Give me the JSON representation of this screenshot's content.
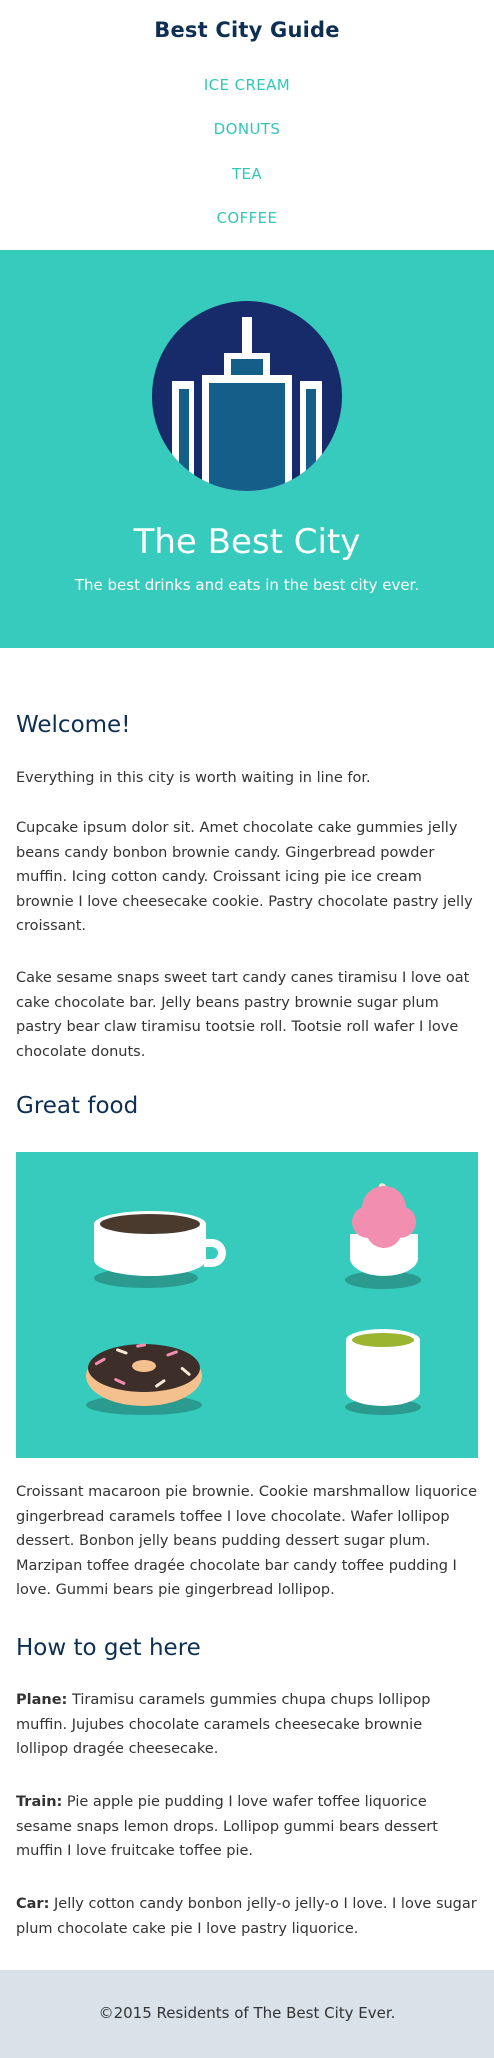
{
  "header": {
    "title": "Best City Guide",
    "nav": [
      "ICE CREAM",
      "DONUTS",
      "TEA",
      "COFFEE"
    ]
  },
  "hero": {
    "title": "The Best City",
    "tagline": "The best drinks and eats in the best city ever."
  },
  "welcome": {
    "heading": "Welcome!",
    "paragraphs": [
      "Everything in this city is worth waiting in line for.",
      "Cupcake ipsum dolor sit. Amet chocolate cake gummies jelly beans candy bonbon brownie candy. Gingerbread powder muffin. Icing cotton candy. Croissant icing pie ice cream brownie I love cheesecake cookie. Pastry chocolate pastry jelly croissant.",
      "Cake sesame snaps sweet tart candy canes tiramisu I love oat cake chocolate bar. Jelly beans pastry brownie sugar plum pastry bear claw tiramisu tootsie roll. Tootsie roll wafer I love chocolate donuts."
    ]
  },
  "food": {
    "heading": "Great food",
    "paragraph": "Croissant macaroon pie brownie. Cookie marshmallow liquorice gingerbread caramels toffee I love chocolate. Wafer lollipop dessert. Bonbon jelly beans pudding dessert sugar plum. Marzipan toffee dragée chocolate bar candy toffee pudding I love. Gummi bears pie gingerbread lollipop."
  },
  "travel": {
    "heading": "How to get here",
    "items": [
      {
        "label": "Plane:",
        "text": " Tiramisu caramels gummies chupa chups lollipop muffin. Jujubes chocolate caramels cheesecake brownie lollipop dragée cheesecake."
      },
      {
        "label": "Train:",
        "text": " Pie apple pie pudding I love wafer toffee liquorice sesame snaps lemon drops. Lollipop gummi bears dessert muffin I love fruitcake toffee pie."
      },
      {
        "label": "Car:",
        "text": " Jelly cotton candy bonbon jelly-o jelly-o I love. I love sugar plum chocolate cake pie I love pastry liquorice."
      }
    ]
  },
  "footer": {
    "text": "©2015 Residents of The Best City Ever."
  },
  "colors": {
    "brand_navy": "#0e2f52",
    "accent_teal": "#36cbbd",
    "nav_teal": "#33c6b8",
    "footer_bg": "#d8e2e8"
  }
}
